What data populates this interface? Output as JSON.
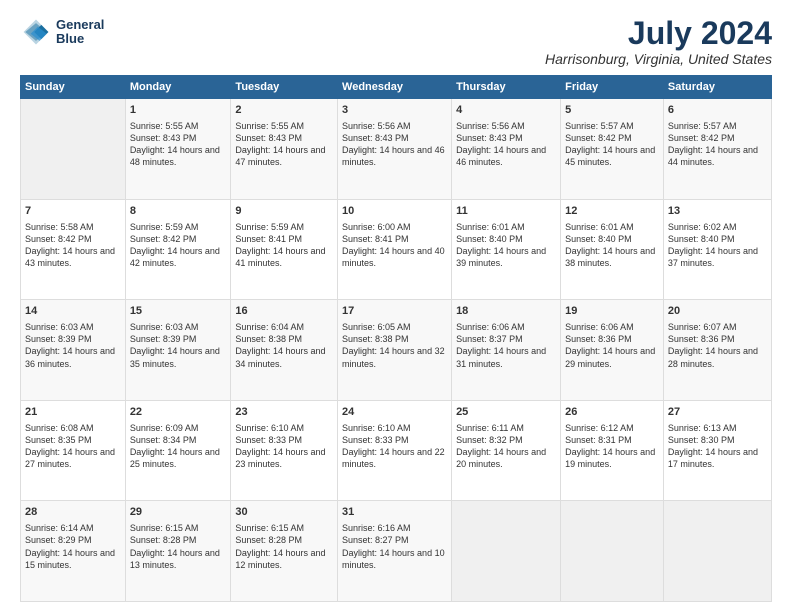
{
  "logo": {
    "line1": "General",
    "line2": "Blue"
  },
  "title": "July 2024",
  "subtitle": "Harrisonburg, Virginia, United States",
  "headers": [
    "Sunday",
    "Monday",
    "Tuesday",
    "Wednesday",
    "Thursday",
    "Friday",
    "Saturday"
  ],
  "rows": [
    [
      {
        "num": "",
        "empty": true
      },
      {
        "num": "1",
        "rise": "5:55 AM",
        "set": "8:43 PM",
        "daylight": "14 hours and 48 minutes."
      },
      {
        "num": "2",
        "rise": "5:55 AM",
        "set": "8:43 PM",
        "daylight": "14 hours and 47 minutes."
      },
      {
        "num": "3",
        "rise": "5:56 AM",
        "set": "8:43 PM",
        "daylight": "14 hours and 46 minutes."
      },
      {
        "num": "4",
        "rise": "5:56 AM",
        "set": "8:43 PM",
        "daylight": "14 hours and 46 minutes."
      },
      {
        "num": "5",
        "rise": "5:57 AM",
        "set": "8:42 PM",
        "daylight": "14 hours and 45 minutes."
      },
      {
        "num": "6",
        "rise": "5:57 AM",
        "set": "8:42 PM",
        "daylight": "14 hours and 44 minutes."
      }
    ],
    [
      {
        "num": "7",
        "rise": "5:58 AM",
        "set": "8:42 PM",
        "daylight": "14 hours and 43 minutes."
      },
      {
        "num": "8",
        "rise": "5:59 AM",
        "set": "8:42 PM",
        "daylight": "14 hours and 42 minutes."
      },
      {
        "num": "9",
        "rise": "5:59 AM",
        "set": "8:41 PM",
        "daylight": "14 hours and 41 minutes."
      },
      {
        "num": "10",
        "rise": "6:00 AM",
        "set": "8:41 PM",
        "daylight": "14 hours and 40 minutes."
      },
      {
        "num": "11",
        "rise": "6:01 AM",
        "set": "8:40 PM",
        "daylight": "14 hours and 39 minutes."
      },
      {
        "num": "12",
        "rise": "6:01 AM",
        "set": "8:40 PM",
        "daylight": "14 hours and 38 minutes."
      },
      {
        "num": "13",
        "rise": "6:02 AM",
        "set": "8:40 PM",
        "daylight": "14 hours and 37 minutes."
      }
    ],
    [
      {
        "num": "14",
        "rise": "6:03 AM",
        "set": "8:39 PM",
        "daylight": "14 hours and 36 minutes."
      },
      {
        "num": "15",
        "rise": "6:03 AM",
        "set": "8:39 PM",
        "daylight": "14 hours and 35 minutes."
      },
      {
        "num": "16",
        "rise": "6:04 AM",
        "set": "8:38 PM",
        "daylight": "14 hours and 34 minutes."
      },
      {
        "num": "17",
        "rise": "6:05 AM",
        "set": "8:38 PM",
        "daylight": "14 hours and 32 minutes."
      },
      {
        "num": "18",
        "rise": "6:06 AM",
        "set": "8:37 PM",
        "daylight": "14 hours and 31 minutes."
      },
      {
        "num": "19",
        "rise": "6:06 AM",
        "set": "8:36 PM",
        "daylight": "14 hours and 29 minutes."
      },
      {
        "num": "20",
        "rise": "6:07 AM",
        "set": "8:36 PM",
        "daylight": "14 hours and 28 minutes."
      }
    ],
    [
      {
        "num": "21",
        "rise": "6:08 AM",
        "set": "8:35 PM",
        "daylight": "14 hours and 27 minutes."
      },
      {
        "num": "22",
        "rise": "6:09 AM",
        "set": "8:34 PM",
        "daylight": "14 hours and 25 minutes."
      },
      {
        "num": "23",
        "rise": "6:10 AM",
        "set": "8:33 PM",
        "daylight": "14 hours and 23 minutes."
      },
      {
        "num": "24",
        "rise": "6:10 AM",
        "set": "8:33 PM",
        "daylight": "14 hours and 22 minutes."
      },
      {
        "num": "25",
        "rise": "6:11 AM",
        "set": "8:32 PM",
        "daylight": "14 hours and 20 minutes."
      },
      {
        "num": "26",
        "rise": "6:12 AM",
        "set": "8:31 PM",
        "daylight": "14 hours and 19 minutes."
      },
      {
        "num": "27",
        "rise": "6:13 AM",
        "set": "8:30 PM",
        "daylight": "14 hours and 17 minutes."
      }
    ],
    [
      {
        "num": "28",
        "rise": "6:14 AM",
        "set": "8:29 PM",
        "daylight": "14 hours and 15 minutes."
      },
      {
        "num": "29",
        "rise": "6:15 AM",
        "set": "8:28 PM",
        "daylight": "14 hours and 13 minutes."
      },
      {
        "num": "30",
        "rise": "6:15 AM",
        "set": "8:28 PM",
        "daylight": "14 hours and 12 minutes."
      },
      {
        "num": "31",
        "rise": "6:16 AM",
        "set": "8:27 PM",
        "daylight": "14 hours and 10 minutes."
      },
      {
        "num": "",
        "empty": true
      },
      {
        "num": "",
        "empty": true
      },
      {
        "num": "",
        "empty": true
      }
    ]
  ],
  "labels": {
    "sunrise": "Sunrise:",
    "sunset": "Sunset:",
    "daylight": "Daylight:"
  }
}
